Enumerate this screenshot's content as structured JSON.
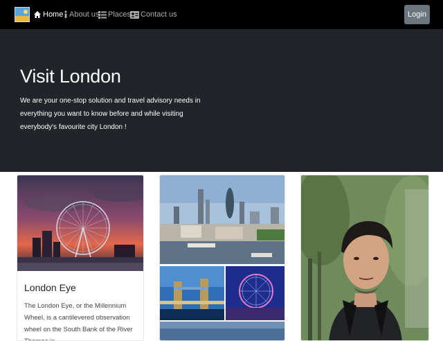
{
  "nav": {
    "brand_icon": "travel-logo-icon",
    "items": [
      {
        "label": "Home",
        "icon": "home-icon"
      },
      {
        "label": "About us",
        "icon": "info-icon"
      },
      {
        "label": "Places",
        "icon": "list-icon"
      },
      {
        "label": "Contact us",
        "icon": "contact-card-icon"
      }
    ],
    "login_label": "Login"
  },
  "hero": {
    "title": "Visit London",
    "text": "We are your one-stop solution and travel advisory needs in everything you want to know before and while visiting everybody's favourite city London !"
  },
  "cards": [
    {
      "title": "London Eye",
      "text": "The London Eye, or the Millennium Wheel, is a cantilevered observation wheel on the South Bank of the River Thames in"
    }
  ],
  "colors": {
    "navbar": "#000000",
    "hero": "#212529",
    "login_button": "#6c757d",
    "nav_active": "#ffffff",
    "nav_inactive": "#a7a9ac"
  }
}
